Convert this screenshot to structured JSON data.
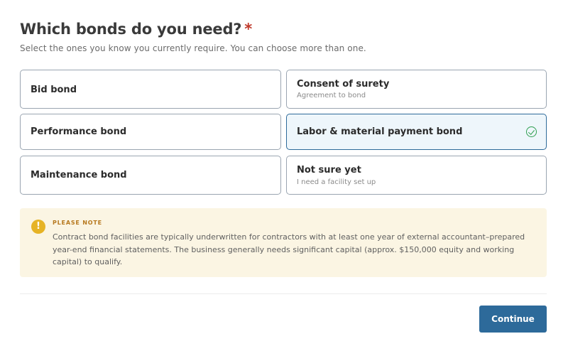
{
  "header": {
    "title": "Which bonds do you need?",
    "required_mark": "*",
    "subtitle": "Select the ones you know you currently require. You can choose more than one."
  },
  "options": [
    {
      "label": "Bid bond",
      "sublabel": "",
      "selected": false
    },
    {
      "label": "Consent of surety",
      "sublabel": "Agreement to bond",
      "selected": false
    },
    {
      "label": "Performance bond",
      "sublabel": "",
      "selected": false
    },
    {
      "label": "Labor & material payment bond",
      "sublabel": "",
      "selected": true
    },
    {
      "label": "Maintenance bond",
      "sublabel": "",
      "selected": false
    },
    {
      "label": "Not sure yet",
      "sublabel": "I need a facility set up",
      "selected": false
    }
  ],
  "note": {
    "icon": "!",
    "heading": "PLEASE NOTE",
    "body": "Contract bond facilities are typically underwritten for contractors with at least one year of external accountant–prepared year-end financial statements. The business generally needs significant capital (approx. $150,000 equity and working capital) to qualify."
  },
  "footer": {
    "continue_label": "Continue"
  },
  "colors": {
    "accent": "#2d6a9a",
    "selected_bg": "#eef6fb",
    "check": "#2e9e4f",
    "note_bg": "#fbf5e3",
    "note_icon": "#e6b325",
    "required": "#c0392b"
  }
}
